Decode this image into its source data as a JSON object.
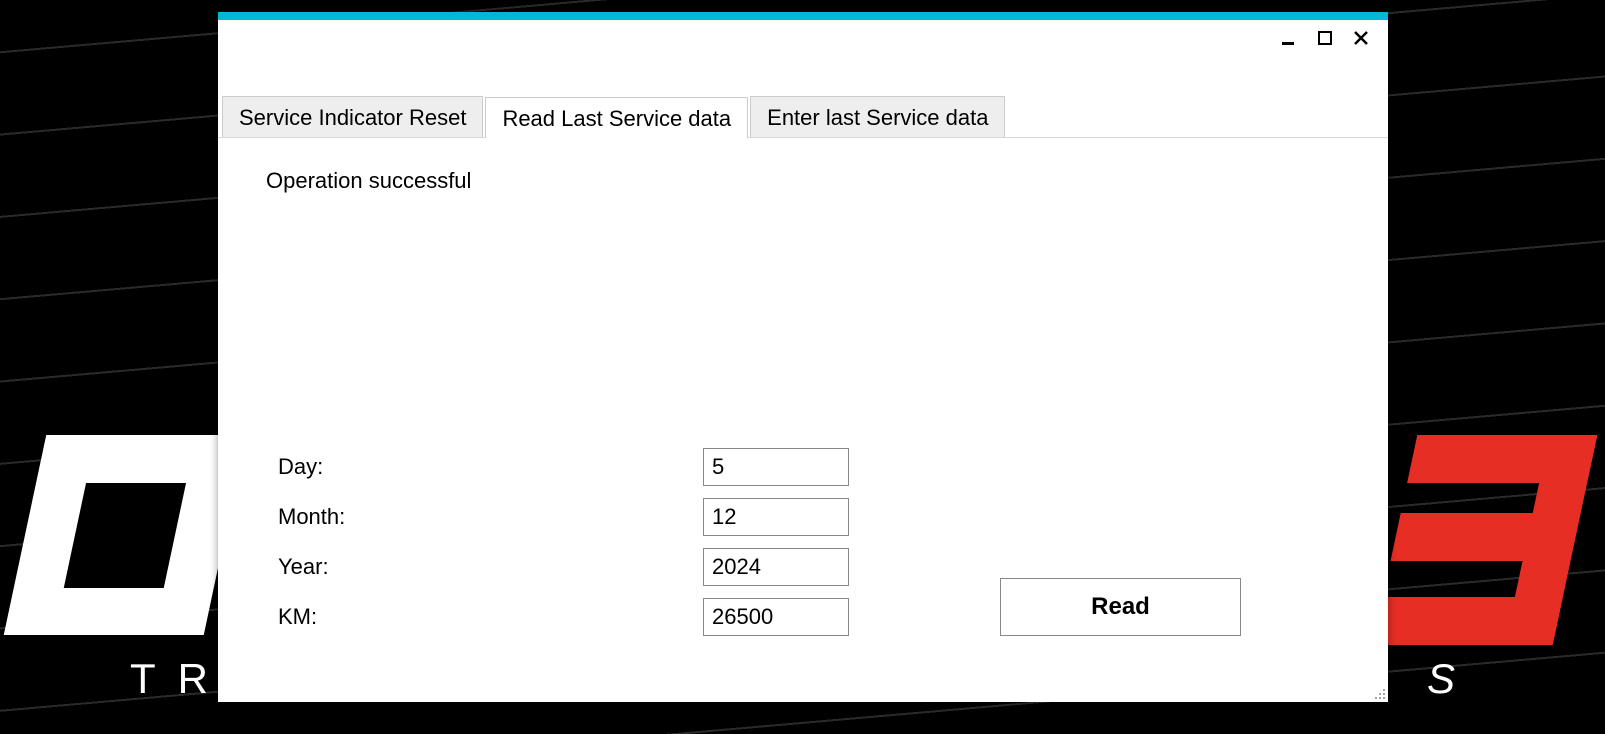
{
  "background": {
    "left_text": "TRU",
    "right_text": "S"
  },
  "window": {
    "controls": {
      "minimize": "minimize",
      "maximize": "maximize",
      "close": "close"
    }
  },
  "tabs": [
    {
      "label": "Service Indicator Reset",
      "active": false
    },
    {
      "label": "Read Last Service data",
      "active": true
    },
    {
      "label": "Enter last Service data",
      "active": false
    }
  ],
  "content": {
    "status": "Operation successful",
    "fields": {
      "day": {
        "label": "Day:",
        "value": "5"
      },
      "month": {
        "label": "Month:",
        "value": "12"
      },
      "year": {
        "label": "Year:",
        "value": "2024"
      },
      "km": {
        "label": "KM:",
        "value": "26500"
      }
    },
    "read_button": "Read"
  }
}
